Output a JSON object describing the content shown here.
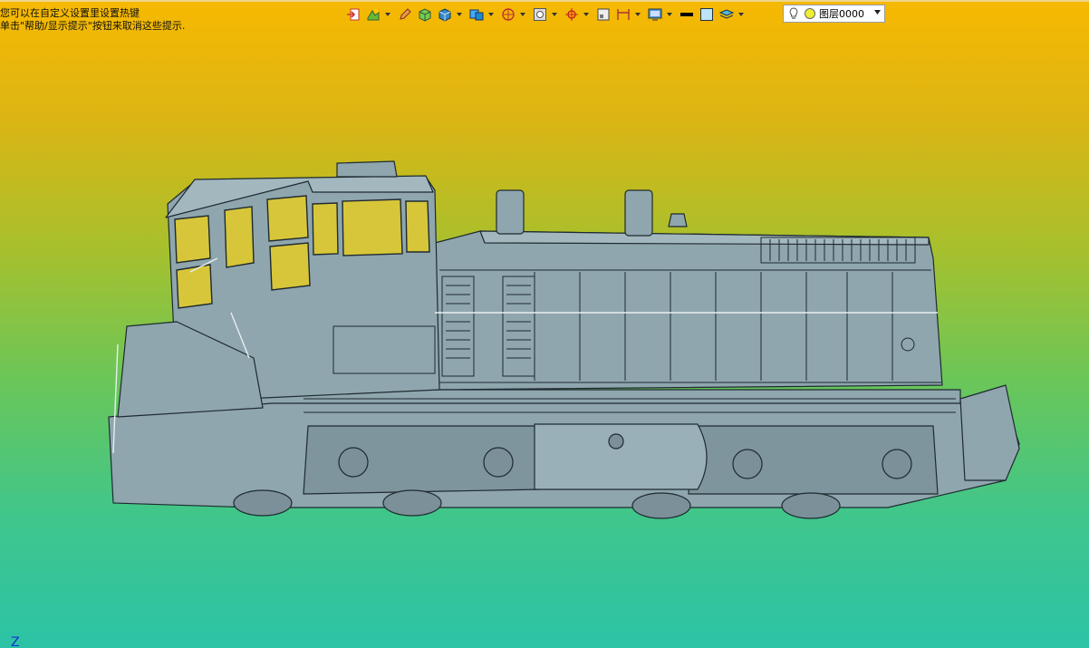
{
  "hint": {
    "line1": "您可以在自定义设置里设置热键",
    "line2": "单击\"帮助/显示提示\"按钮来取消这些提示."
  },
  "toolbar": {
    "icons": [
      "exit-sketch-icon",
      "feature-icon",
      "pencil-icon",
      "box-shaded-icon",
      "cube-icon",
      "view-orientation-icon",
      "section-view-icon",
      "zoom-fit-icon",
      "target-icon",
      "frame-icon",
      "dimension-icon",
      "display-mode-icon",
      "line-color-icon",
      "face-color-icon",
      "layer-stack-icon"
    ]
  },
  "layer": {
    "name": "图层0000"
  },
  "axis": {
    "label": "Z"
  },
  "colors": {
    "model_fill": "#8fa6ae",
    "model_stroke": "#1e2a30",
    "bg_top": "#f7b900",
    "bg_bottom": "#2cc3a6"
  }
}
